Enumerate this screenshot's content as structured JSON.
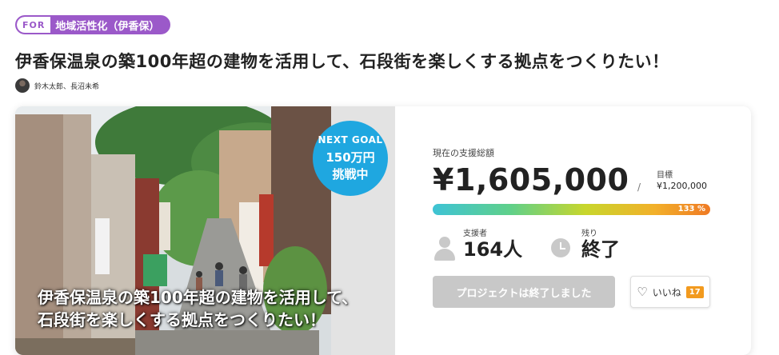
{
  "tag": {
    "prefix": "FOR",
    "label": "地域活性化（伊香保）"
  },
  "title": "伊香保温泉の築100年超の建物を活用して、石段街を楽しくする拠点をつくりたい！",
  "authors": "鈴木太郎、長沼未希",
  "hero": {
    "caption_line1": "伊香保温泉の築100年超の建物を活用して、",
    "caption_line2": "石段街を楽しくする拠点をつくりたい！",
    "goal_badge": {
      "line1": "NEXT GOAL",
      "line2": "150万円",
      "line3": "挑戦中"
    }
  },
  "stats": {
    "current_label": "現在の支援総額",
    "current_amount": "¥1,605,000",
    "slash": "/",
    "target_label": "目標",
    "target_amount": "¥1,200,000",
    "progress_percent": 133,
    "progress_label": "133 %",
    "backers_label": "支援者",
    "backers_value": "164人",
    "remaining_label": "残り",
    "remaining_value": "終了"
  },
  "actions": {
    "ended_button": "プロジェクトは終了しました",
    "like_label": "いいね",
    "like_count": "17"
  },
  "colors": {
    "accent": "#9b59c9",
    "badge": "#1fa7e0",
    "like_count": "#f29a1e"
  },
  "icons": [
    "avatar",
    "person-icon",
    "clock-icon",
    "heart-icon"
  ]
}
